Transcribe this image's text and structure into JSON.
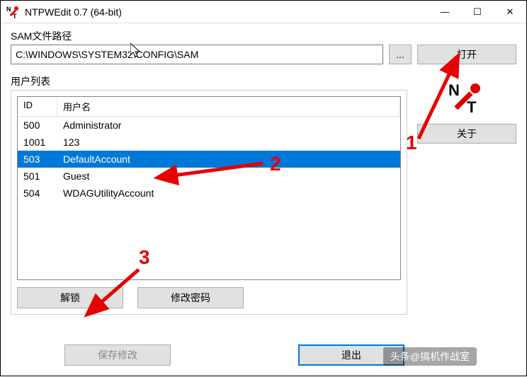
{
  "app": {
    "title": "NTPWEdit 0.7 (64-bit)"
  },
  "win_controls": {
    "minimize": "—",
    "maximize": "☐",
    "close": "✕"
  },
  "labels": {
    "sam_path": "SAM文件路径",
    "user_list": "用户列表"
  },
  "path": {
    "value": "C:\\WINDOWS\\SYSTEM32\\CONFIG\\SAM"
  },
  "buttons": {
    "browse": "...",
    "open": "打开",
    "about": "关于",
    "unlock": "解锁",
    "change_pw": "修改密码",
    "save": "保存修改",
    "cancel": "退出"
  },
  "columns": {
    "id": "ID",
    "username": "用户名"
  },
  "users": [
    {
      "id": "500",
      "name": "Administrator",
      "selected": false
    },
    {
      "id": "1001",
      "name": "123",
      "selected": false
    },
    {
      "id": "503",
      "name": "DefaultAccount",
      "selected": true
    },
    {
      "id": "501",
      "name": "Guest",
      "selected": false
    },
    {
      "id": "504",
      "name": "WDAGUtilityAccount",
      "selected": false
    }
  ],
  "annotations": {
    "n1": "1",
    "n2": "2",
    "n3": "3"
  },
  "watermark": "头条@搞机作战室"
}
